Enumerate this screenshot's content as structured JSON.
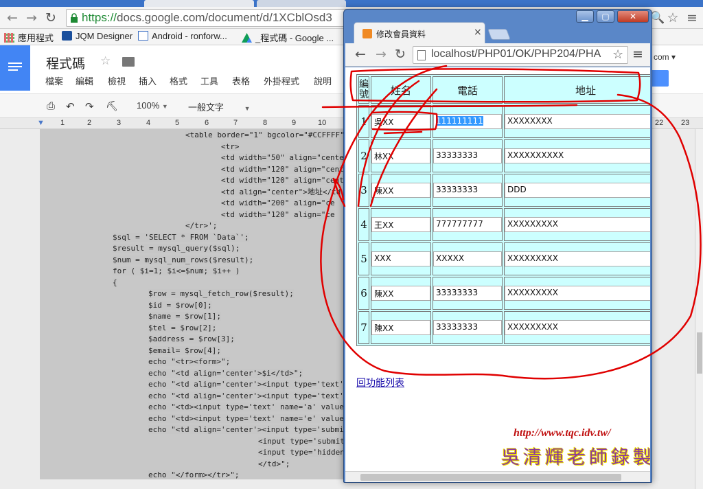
{
  "background_window": {
    "url_scheme": "https://",
    "url_rest": "docs.google.com/document/d/1XCblOsd3",
    "bookmarks": [
      "應用程式",
      "JQM Designer",
      "Android - ronforw...",
      "_程式碼 - Google ..."
    ],
    "doc_title": "程式碼",
    "menus": [
      "檔案",
      "編輯",
      "檢視",
      "插入",
      "格式",
      "工具",
      "表格",
      "外掛程式",
      "說明"
    ],
    "toolbar": {
      "zoom": "100%",
      "style": "一般文字"
    },
    "ruler": [
      "1",
      "2",
      "3",
      "4",
      "5",
      "6",
      "7",
      "8",
      "9",
      "10",
      "22",
      "23"
    ],
    "right_partial_text": "com ▾",
    "code_lines": [
      "<table border=\"1\" bgcolor=\"#CCFFFF\"",
      "<tr>",
      "<td width=\"50\" align=\"cente",
      "<td width=\"120\" align=\"cent",
      "<td width=\"120\" align=\"cent",
      "<td align=\"center\">地址</td",
      "<td width=\"200\" align=\"ce",
      "<td width=\"120\" align=\"ce",
      "</tr>';",
      "$sql = 'SELECT * FROM `Data`';",
      "$result = mysql_query($sql);",
      "$num = mysql_num_rows($result);",
      "for ( $i=1; $i<=$num; $i++ )",
      "{",
      "$row = mysql_fetch_row($result);",
      "$id = $row[0];",
      "$name = $row[1];",
      "$tel = $row[2];",
      "$address = $row[3];",
      "$email= $row[4];",
      "echo \"<tr><form>\";",
      "echo \"<td align='center'>$i</td>\";",
      "echo \"<td align='center'><input type='text'",
      "echo \"<td align='center'><input type='text'",
      "echo \"<td><input type='text' name='a' value",
      "echo \"<td><input type='text' name='e' value",
      "echo \"<td align='center'><input type='submi",
      "<input type='submit",
      "<input type='hidden",
      "</td>\";",
      "echo \"</form></tr>\";"
    ]
  },
  "popup_window": {
    "tab_title": "修改會員資料",
    "url": "localhost/PHP01/OK/PHP204/PHA",
    "table": {
      "headers": [
        "編號",
        "姓名",
        "電話",
        "地址"
      ],
      "rows": [
        {
          "num": "1",
          "name": "吳XX",
          "tel": "111111111",
          "addr": "XXXXXXXX"
        },
        {
          "num": "2",
          "name": "林XX",
          "tel": "33333333",
          "addr": "XXXXXXXXXX"
        },
        {
          "num": "3",
          "name": "陳XX",
          "tel": "33333333",
          "addr": "DDD"
        },
        {
          "num": "4",
          "name": "王XX",
          "tel": "777777777",
          "addr": "XXXXXXXXX"
        },
        {
          "num": "5",
          "name": "XXX",
          "tel": "XXXXX",
          "addr": "XXXXXXXXX"
        },
        {
          "num": "6",
          "name": "陳XX",
          "tel": "33333333",
          "addr": "XXXXXXXXX"
        },
        {
          "num": "7",
          "name": "陳XX",
          "tel": "33333333",
          "addr": "XXXXXXXXX"
        }
      ]
    },
    "back_link": "回功能列表"
  },
  "watermark": {
    "url": "http://www.tqc.idv.tw/",
    "name": "吳清輝老師錄製"
  },
  "colors": {
    "table_bg": "#CCFFFF",
    "annotation": "#e00000",
    "docs_blue": "#4285f4"
  }
}
